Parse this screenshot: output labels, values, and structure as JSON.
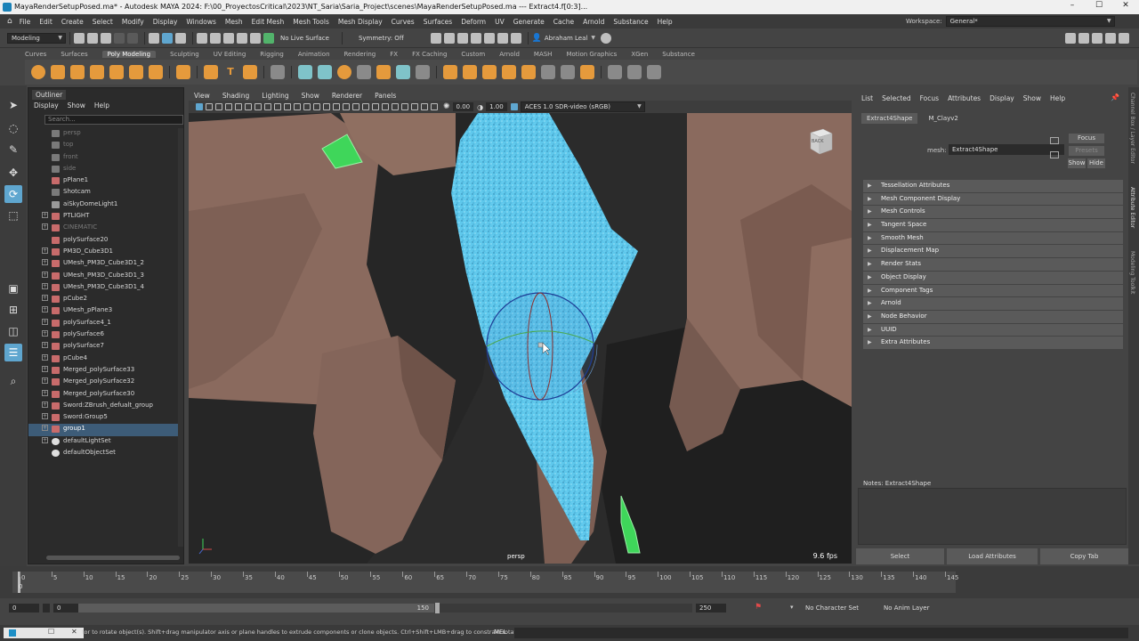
{
  "window": {
    "title": "MayaRenderSetupPosed.ma* - Autodesk MAYA 2024: F:\\00_ProyectosCritical\\2023\\NT_Saria\\Saria_Project\\scenes\\MayaRenderSetupPosed.ma   ---   Extract4.f[0:3]...",
    "min": "–",
    "max": "☐",
    "close": "✕"
  },
  "menubar": [
    "File",
    "Edit",
    "Create",
    "Select",
    "Modify",
    "Display",
    "Windows",
    "Mesh",
    "Edit Mesh",
    "Mesh Tools",
    "Mesh Display",
    "Curves",
    "Surfaces",
    "Deform",
    "UV",
    "Generate",
    "Cache",
    "Arnold",
    "Substance",
    "Help"
  ],
  "workspace": {
    "label": "Workspace:",
    "value": "General*"
  },
  "statusline": {
    "mode": "Modeling",
    "live_surface": "No Live Surface",
    "symmetry": "Symmetry: Off",
    "user": "Abraham Leal"
  },
  "shelf_tabs": [
    "Curves",
    "Surfaces",
    "Poly Modeling",
    "Sculpting",
    "UV Editing",
    "Rigging",
    "Animation",
    "Rendering",
    "FX",
    "FX Caching",
    "Custom",
    "Arnold",
    "MASH",
    "Motion Graphics",
    "XGen",
    "Substance"
  ],
  "shelf_active": "Poly Modeling",
  "outliner": {
    "title": "Outliner",
    "menu": [
      "Display",
      "Show",
      "Help"
    ],
    "search_placeholder": "Search...",
    "items": [
      {
        "label": "persp",
        "type": "cam",
        "dim": true,
        "exp": false
      },
      {
        "label": "top",
        "type": "cam",
        "dim": true,
        "exp": false
      },
      {
        "label": "front",
        "type": "cam",
        "dim": true,
        "exp": false
      },
      {
        "label": "side",
        "type": "cam",
        "dim": true,
        "exp": false
      },
      {
        "label": "pPlane1",
        "type": "mesh",
        "dim": false,
        "exp": false
      },
      {
        "label": "Shotcam",
        "type": "cam",
        "dim": false,
        "exp": false
      },
      {
        "label": "aiSkyDomeLight1",
        "type": "light",
        "dim": false,
        "exp": false
      },
      {
        "label": "PTLIGHT",
        "type": "mesh",
        "dim": false,
        "exp": true
      },
      {
        "label": "CINEMATIC",
        "type": "mesh",
        "dim": true,
        "exp": true
      },
      {
        "label": "polySurface20",
        "type": "mesh",
        "dim": false,
        "exp": false
      },
      {
        "label": "PM3D_Cube3D1",
        "type": "mesh",
        "dim": false,
        "exp": true
      },
      {
        "label": "UMesh_PM3D_Cube3D1_2",
        "type": "mesh",
        "dim": false,
        "exp": true
      },
      {
        "label": "UMesh_PM3D_Cube3D1_3",
        "type": "mesh",
        "dim": false,
        "exp": true
      },
      {
        "label": "UMesh_PM3D_Cube3D1_4",
        "type": "mesh",
        "dim": false,
        "exp": true
      },
      {
        "label": "pCube2",
        "type": "mesh",
        "dim": false,
        "exp": true
      },
      {
        "label": "UMesh_pPlane3",
        "type": "mesh",
        "dim": false,
        "exp": true
      },
      {
        "label": "polySurface4_1",
        "type": "mesh",
        "dim": false,
        "exp": true
      },
      {
        "label": "polySurface6",
        "type": "mesh",
        "dim": false,
        "exp": true
      },
      {
        "label": "polySurface7",
        "type": "mesh",
        "dim": false,
        "exp": true
      },
      {
        "label": "pCube4",
        "type": "mesh",
        "dim": false,
        "exp": true
      },
      {
        "label": "Merged_polySurface33",
        "type": "mesh",
        "dim": false,
        "exp": true
      },
      {
        "label": "Merged_polySurface32",
        "type": "mesh",
        "dim": false,
        "exp": true
      },
      {
        "label": "Merged_polySurface30",
        "type": "mesh",
        "dim": false,
        "exp": true
      },
      {
        "label": "Sword:ZBrush_defualt_group",
        "type": "mesh",
        "dim": false,
        "exp": true
      },
      {
        "label": "Sword:Group5",
        "type": "mesh",
        "dim": false,
        "exp": true
      },
      {
        "label": "group1",
        "type": "mesh",
        "dim": false,
        "exp": true,
        "selected": true
      },
      {
        "label": "defaultLightSet",
        "type": "set",
        "dim": false,
        "exp": true
      },
      {
        "label": "defaultObjectSet",
        "type": "set",
        "dim": false,
        "exp": false
      }
    ]
  },
  "viewport": {
    "menu": [
      "View",
      "Shading",
      "Lighting",
      "Show",
      "Renderer",
      "Panels"
    ],
    "exposure": "0.00",
    "gamma": "1.00",
    "colorspace": "ACES 1.0 SDR-video (sRGB)",
    "camera": "persp",
    "fps": "9.6 fps",
    "viewcube_label": "BACK"
  },
  "attribute_editor": {
    "menu": [
      "List",
      "Selected",
      "Focus",
      "Attributes",
      "Display",
      "Show",
      "Help"
    ],
    "tabs": [
      "Extract4Shape",
      "M_Clayv2"
    ],
    "mesh_label": "mesh:",
    "mesh_value": "Extract4Shape",
    "focus": "Focus",
    "presets": "Presets",
    "show": "Show",
    "hide": "Hide",
    "sections": [
      "Tessellation Attributes",
      "Mesh Component Display",
      "Mesh Controls",
      "Tangent Space",
      "Smooth Mesh",
      "Displacement Map",
      "Render Stats",
      "Object Display",
      "Component Tags",
      "Arnold",
      "Node Behavior",
      "UUID",
      "Extra Attributes"
    ],
    "notes_label": "Notes:  Extract4Shape",
    "buttons": [
      "Select",
      "Load Attributes",
      "Copy Tab"
    ]
  },
  "side_tabs": [
    "Channel Box / Layer Editor",
    "Attribute Editor",
    "Modeling Toolkit"
  ],
  "timeline": {
    "ticks": [
      0,
      5,
      10,
      15,
      20,
      25,
      30,
      35,
      40,
      45,
      50,
      55,
      60,
      65,
      70,
      75,
      80,
      85,
      90,
      95,
      100,
      105,
      110,
      115,
      120,
      125,
      130,
      135,
      140,
      145
    ],
    "current": "0"
  },
  "range": {
    "start": "0",
    "inner_start": "0",
    "inner_end": "150",
    "end": "250",
    "character_set": "No Character Set",
    "anim_layer": "No Anim Layer"
  },
  "help_line": {
    "text": "tor to rotate object(s). Shift+drag manipulator axis or plane handles to extrude components or clone objects. Ctrl+Shift+LMB+drag to constrain rotatio",
    "mel": "MEL"
  },
  "colors": {
    "accent": "#5fa6cf",
    "mesh_skin": "#8a6a5e",
    "extract_mesh": "#5ec8ec",
    "green_gem": "#3fd65a"
  }
}
